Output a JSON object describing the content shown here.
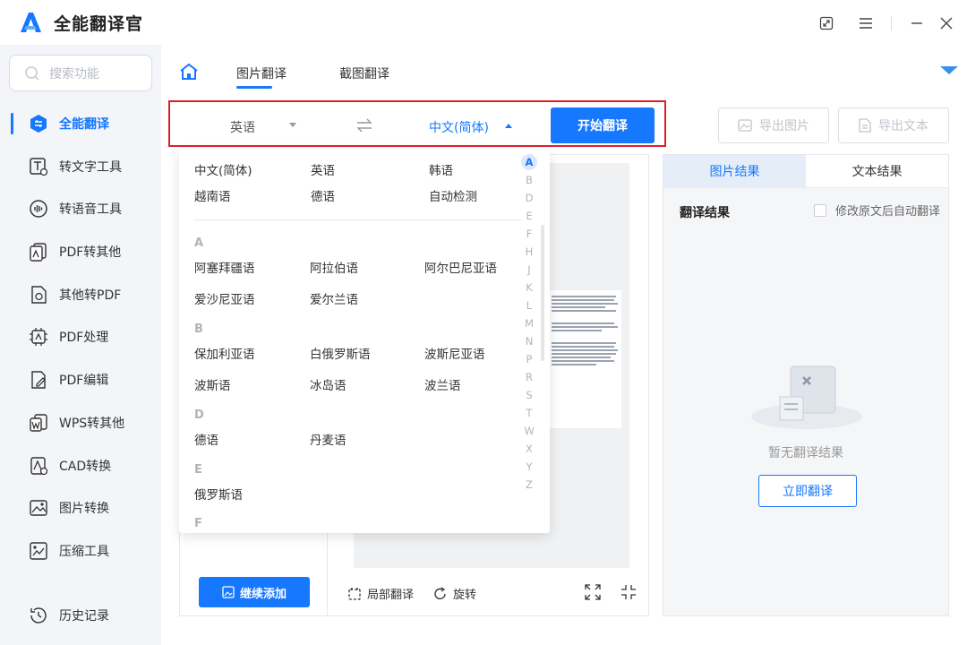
{
  "app": {
    "title": "全能翻译官"
  },
  "sidebar": {
    "search_placeholder": "搜索功能",
    "items": [
      {
        "label": "全能翻译",
        "icon": "translate-icon"
      },
      {
        "label": "转文字工具",
        "icon": "text-convert-icon"
      },
      {
        "label": "转语音工具",
        "icon": "voice-icon"
      },
      {
        "label": "PDF转其他",
        "icon": "pdf-export-icon"
      },
      {
        "label": "其他转PDF",
        "icon": "to-pdf-icon"
      },
      {
        "label": "PDF处理",
        "icon": "pdf-process-icon"
      },
      {
        "label": "PDF编辑",
        "icon": "pdf-edit-icon"
      },
      {
        "label": "WPS转其他",
        "icon": "wps-icon"
      },
      {
        "label": "CAD转换",
        "icon": "cad-icon"
      },
      {
        "label": "图片转换",
        "icon": "image-convert-icon"
      },
      {
        "label": "压缩工具",
        "icon": "compress-icon"
      },
      {
        "label": "历史记录",
        "icon": "history-icon"
      }
    ]
  },
  "main": {
    "tabs": [
      {
        "label": "图片翻译"
      },
      {
        "label": "截图翻译"
      }
    ],
    "source_lang": "英语",
    "target_lang": "中文(简体)",
    "start_button": "开始翻译",
    "export_image": "导出图片",
    "export_text": "导出文本",
    "add_more": "继续添加",
    "partial_translate": "局部翻译",
    "rotate": "旋转"
  },
  "right_panel": {
    "tabs": [
      {
        "label": "图片结果"
      },
      {
        "label": "文本结果"
      }
    ],
    "result_title": "翻译结果",
    "auto_translate_label": "修改原文后自动翻译",
    "empty_text": "暂无翻译结果",
    "translate_now": "立即翻译"
  },
  "dropdown": {
    "common": [
      "中文(简体)",
      "英语",
      "韩语",
      "越南语",
      "德语",
      "自动检测"
    ],
    "groups": [
      {
        "letter": "A",
        "items": [
          "阿塞拜疆语",
          "阿拉伯语",
          "阿尔巴尼亚语",
          "爱沙尼亚语",
          "爱尔兰语"
        ]
      },
      {
        "letter": "B",
        "items": [
          "保加利亚语",
          "白俄罗斯语",
          "波斯尼亚语",
          "波斯语",
          "冰岛语",
          "波兰语"
        ]
      },
      {
        "letter": "D",
        "items": [
          "德语",
          "丹麦语"
        ]
      },
      {
        "letter": "E",
        "items": [
          "俄罗斯语"
        ]
      },
      {
        "letter": "F",
        "items": []
      }
    ],
    "alphabet": [
      "A",
      "B",
      "D",
      "E",
      "F",
      "H",
      "J",
      "K",
      "L",
      "M",
      "N",
      "P",
      "R",
      "S",
      "T",
      "W",
      "X",
      "Y",
      "Z"
    ]
  },
  "colors": {
    "accent": "#1677ff",
    "highlight_border": "#d8232a"
  }
}
